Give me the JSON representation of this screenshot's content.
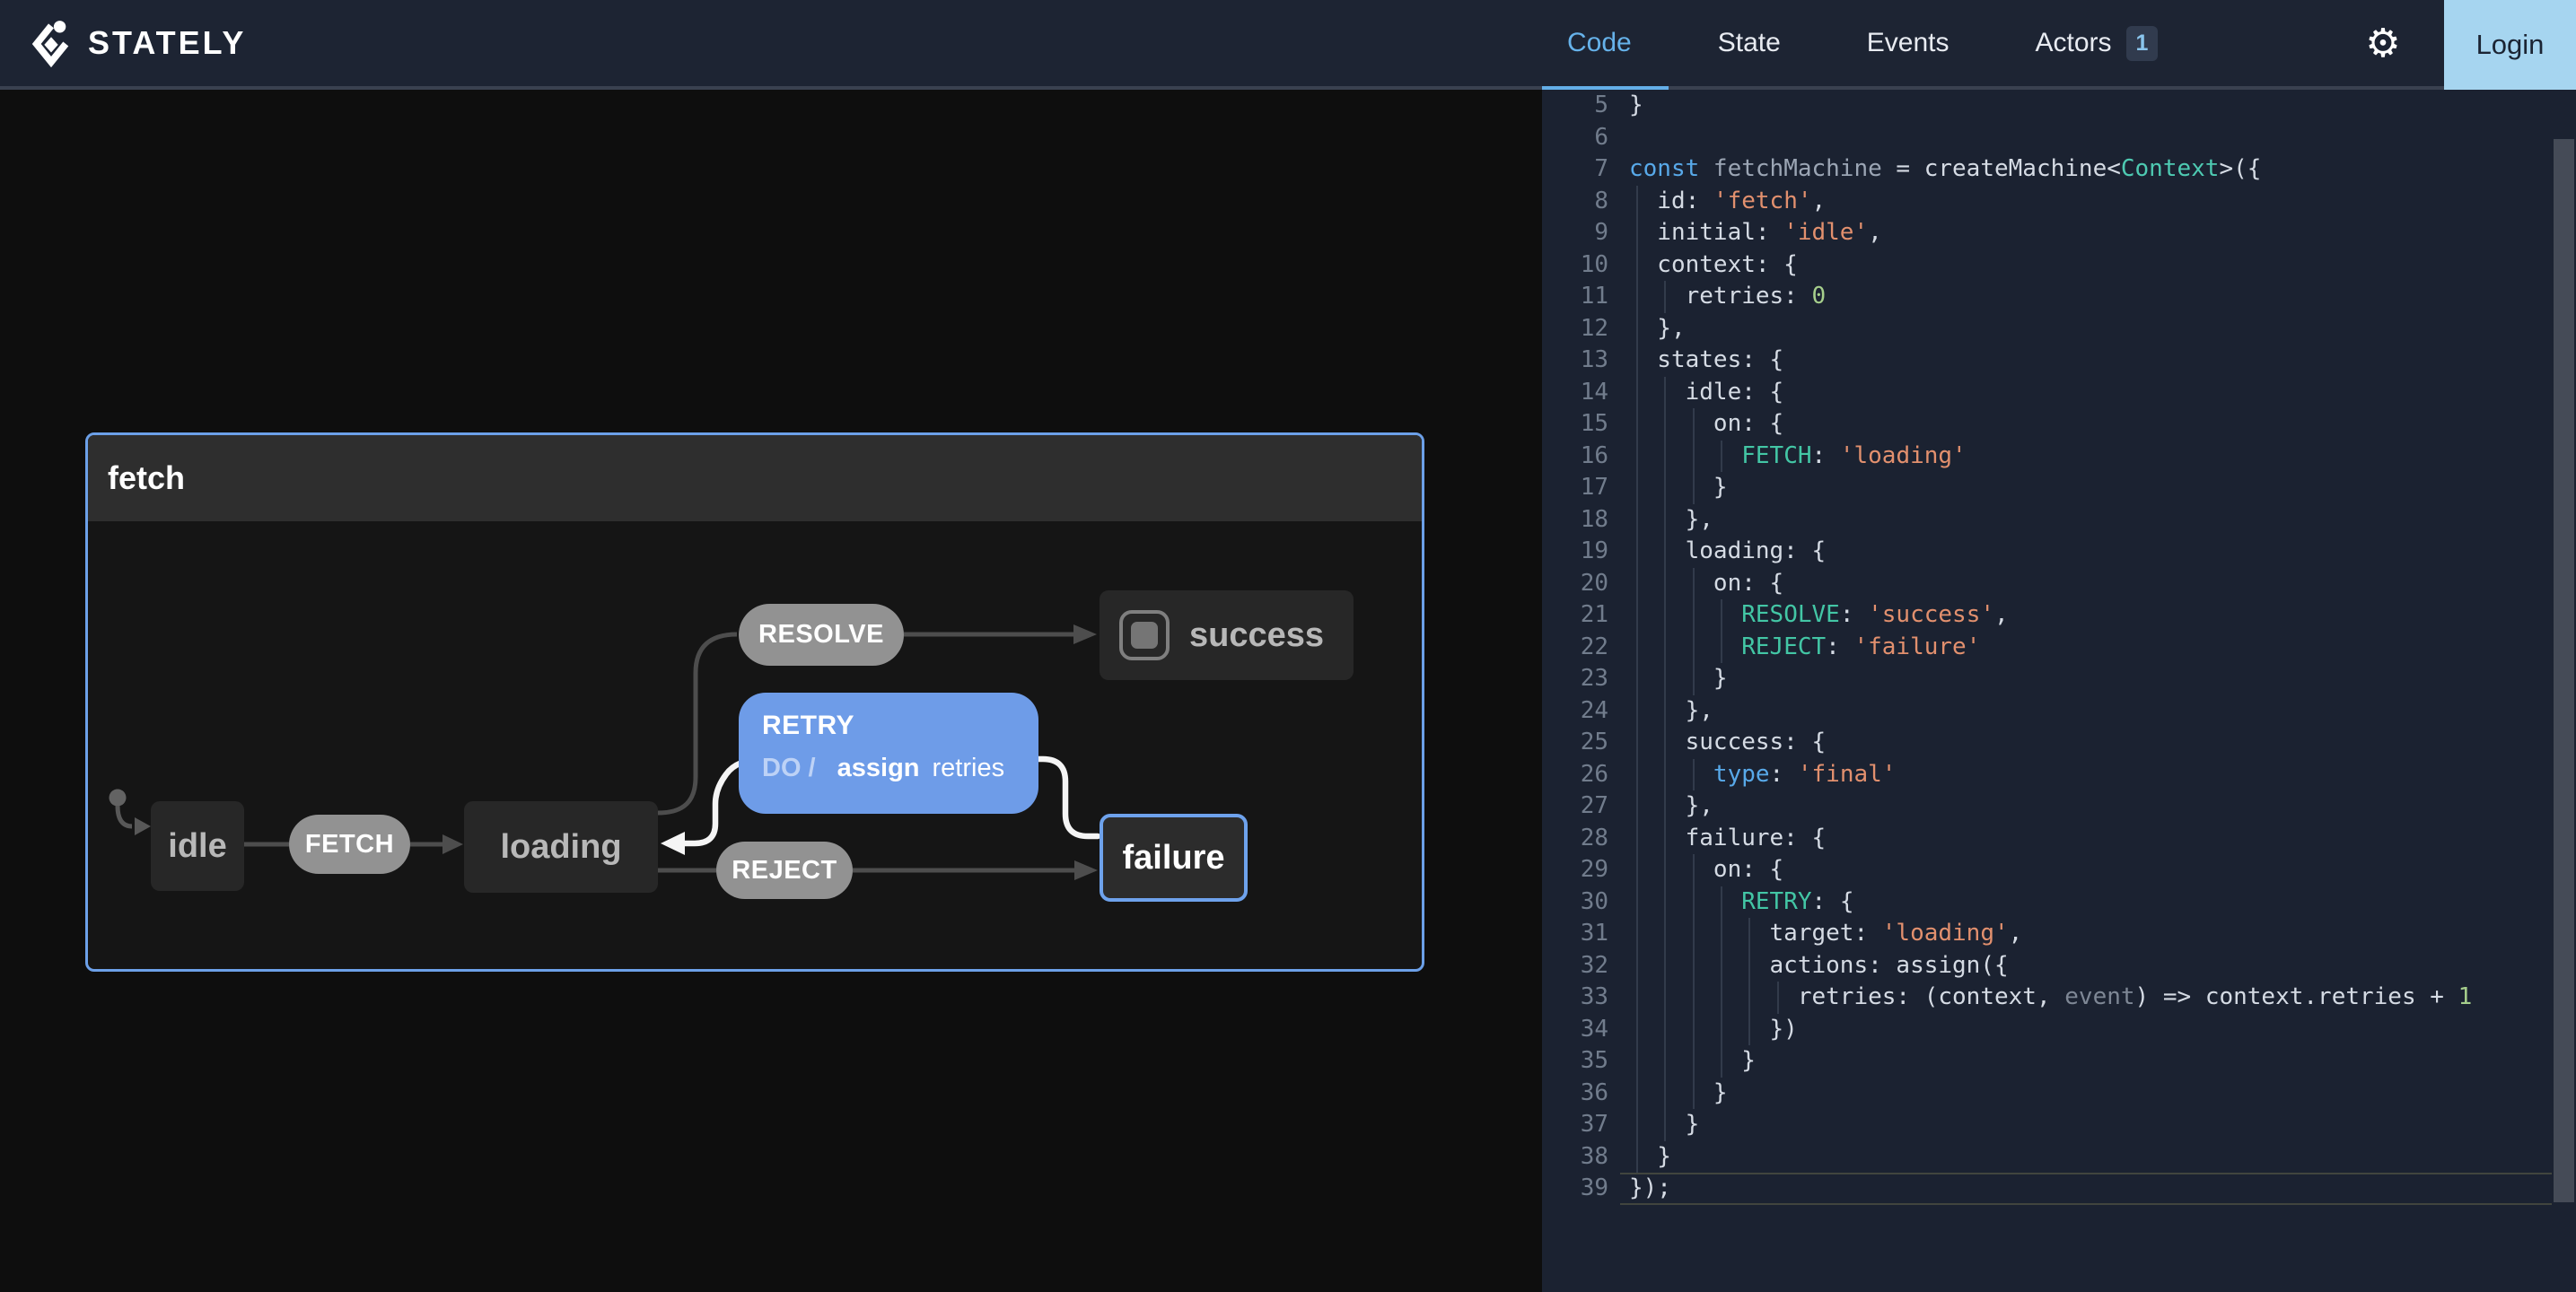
{
  "nav": {
    "brand": "STATELY",
    "tabs": [
      {
        "label": "Code",
        "active": true
      },
      {
        "label": "State",
        "active": false
      },
      {
        "label": "Events",
        "active": false
      },
      {
        "label": "Actors",
        "active": false,
        "badge": "1"
      }
    ],
    "login_label": "Login"
  },
  "diagram": {
    "machine_title": "fetch",
    "states": {
      "idle": {
        "label": "idle"
      },
      "loading": {
        "label": "loading"
      },
      "success": {
        "label": "success",
        "type": "final"
      },
      "failure": {
        "label": "failure",
        "selected": true
      }
    },
    "events": {
      "fetch": {
        "label": "FETCH"
      },
      "resolve": {
        "label": "RESOLVE"
      },
      "reject": {
        "label": "REJECT"
      },
      "retry": {
        "label": "RETRY",
        "do_prefix": "DO /",
        "action_name": "assign",
        "action_arg": "retries",
        "highlighted": true
      }
    }
  },
  "colors": {
    "accent_blue": "#6e9ce8",
    "selection_border": "#6ea2ec",
    "machine_border": "#6ca0e8",
    "tab_active": "#66b2ea",
    "login_bg": "#a6d5f0",
    "nav_bg": "#1d2433",
    "code_bg": "#1b2231",
    "string": "#e2906e",
    "keyword": "#58a9e9",
    "event_token": "#43c6a5"
  },
  "code": {
    "first_line": 5,
    "lines": [
      {
        "n": 5,
        "t": [
          [
            "}",
            "d"
          ]
        ]
      },
      {
        "n": 6,
        "t": []
      },
      {
        "n": 7,
        "t": [
          [
            "const ",
            "k"
          ],
          [
            "fetchMachine",
            "i"
          ],
          [
            " = createMachine<",
            "d"
          ],
          [
            "Context",
            "y"
          ],
          [
            ">({",
            "d"
          ]
        ]
      },
      {
        "n": 8,
        "t": [
          [
            "  id: ",
            "d"
          ],
          [
            "'fetch'",
            "s"
          ],
          [
            ",",
            "d"
          ]
        ]
      },
      {
        "n": 9,
        "t": [
          [
            "  initial: ",
            "d"
          ],
          [
            "'idle'",
            "s"
          ],
          [
            ",",
            "d"
          ]
        ]
      },
      {
        "n": 10,
        "t": [
          [
            "  context: {",
            "d"
          ]
        ]
      },
      {
        "n": 11,
        "t": [
          [
            "    retries: ",
            "d"
          ],
          [
            "0",
            "n"
          ]
        ]
      },
      {
        "n": 12,
        "t": [
          [
            "  },",
            "d"
          ]
        ]
      },
      {
        "n": 13,
        "t": [
          [
            "  states: {",
            "d"
          ]
        ]
      },
      {
        "n": 14,
        "t": [
          [
            "    idle: {",
            "d"
          ]
        ]
      },
      {
        "n": 15,
        "t": [
          [
            "      on: {",
            "d"
          ]
        ]
      },
      {
        "n": 16,
        "t": [
          [
            "        ",
            "d"
          ],
          [
            "FETCH",
            "e"
          ],
          [
            ": ",
            "d"
          ],
          [
            "'loading'",
            "s"
          ]
        ]
      },
      {
        "n": 17,
        "t": [
          [
            "      }",
            "d"
          ]
        ]
      },
      {
        "n": 18,
        "t": [
          [
            "    },",
            "d"
          ]
        ]
      },
      {
        "n": 19,
        "t": [
          [
            "    loading: {",
            "d"
          ]
        ]
      },
      {
        "n": 20,
        "t": [
          [
            "      on: {",
            "d"
          ]
        ]
      },
      {
        "n": 21,
        "t": [
          [
            "        ",
            "d"
          ],
          [
            "RESOLVE",
            "e"
          ],
          [
            ": ",
            "d"
          ],
          [
            "'success'",
            "s"
          ],
          [
            ",",
            "d"
          ]
        ]
      },
      {
        "n": 22,
        "t": [
          [
            "        ",
            "d"
          ],
          [
            "REJECT",
            "e"
          ],
          [
            ": ",
            "d"
          ],
          [
            "'failure'",
            "s"
          ]
        ]
      },
      {
        "n": 23,
        "t": [
          [
            "      }",
            "d"
          ]
        ]
      },
      {
        "n": 24,
        "t": [
          [
            "    },",
            "d"
          ]
        ]
      },
      {
        "n": 25,
        "t": [
          [
            "    success: {",
            "d"
          ]
        ]
      },
      {
        "n": 26,
        "t": [
          [
            "      ",
            "d"
          ],
          [
            "type",
            "k"
          ],
          [
            ": ",
            "d"
          ],
          [
            "'final'",
            "s"
          ]
        ]
      },
      {
        "n": 27,
        "t": [
          [
            "    },",
            "d"
          ]
        ]
      },
      {
        "n": 28,
        "t": [
          [
            "    failure: {",
            "d"
          ]
        ]
      },
      {
        "n": 29,
        "t": [
          [
            "      on: {",
            "d"
          ]
        ]
      },
      {
        "n": 30,
        "t": [
          [
            "        ",
            "d"
          ],
          [
            "RETRY",
            "e"
          ],
          [
            ": {",
            "d"
          ]
        ]
      },
      {
        "n": 31,
        "t": [
          [
            "          target: ",
            "d"
          ],
          [
            "'loading'",
            "s"
          ],
          [
            ",",
            "d"
          ]
        ]
      },
      {
        "n": 32,
        "t": [
          [
            "          actions: assign({",
            "d"
          ]
        ]
      },
      {
        "n": 33,
        "t": [
          [
            "            retries: (context, ",
            "d"
          ],
          [
            "event",
            "m"
          ],
          [
            ") => context.retries + ",
            "d"
          ],
          [
            "1",
            "n"
          ]
        ]
      },
      {
        "n": 34,
        "t": [
          [
            "          })",
            "d"
          ]
        ]
      },
      {
        "n": 35,
        "t": [
          [
            "        }",
            "d"
          ]
        ]
      },
      {
        "n": 36,
        "t": [
          [
            "      }",
            "d"
          ]
        ]
      },
      {
        "n": 37,
        "t": [
          [
            "    }",
            "d"
          ]
        ]
      },
      {
        "n": 38,
        "t": [
          [
            "  }",
            "d"
          ]
        ]
      },
      {
        "n": 39,
        "t": [
          [
            "});",
            "d"
          ]
        ]
      }
    ],
    "active_line": 39
  }
}
